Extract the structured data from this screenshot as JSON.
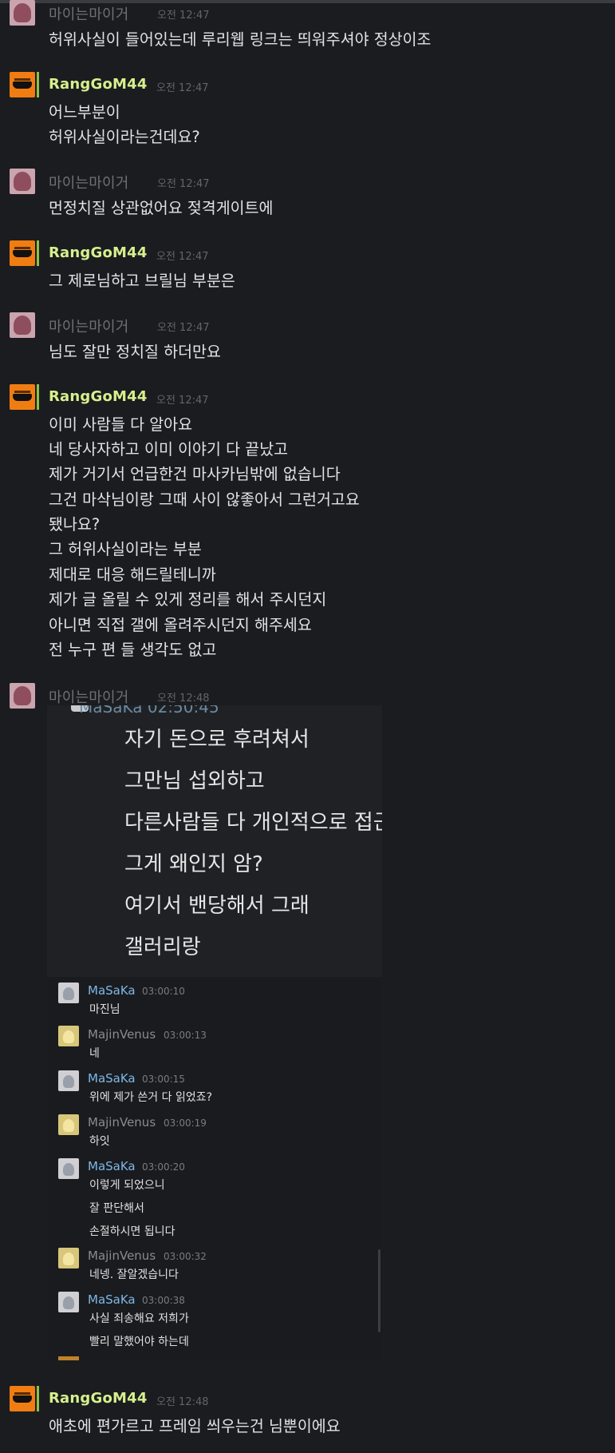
{
  "messages": [
    {
      "author": "마이는마이거",
      "time": "오전 12:47",
      "lines": [
        "허위사실이 들어있는데 루리웹 링크는 띄워주셔야 정상이조"
      ]
    },
    {
      "author": "RangGoM44",
      "time": "오전 12:47",
      "lines": [
        "어느부분이",
        "허위사실이라는건데요?"
      ]
    },
    {
      "author": "마이는마이거",
      "time": "오전 12:47",
      "lines": [
        "먼정치질 상관없어요 젖격게이트에"
      ]
    },
    {
      "author": "RangGoM44",
      "time": "오전 12:47",
      "lines": [
        "그 제로님하고 브릴님 부분은"
      ]
    },
    {
      "author": "마이는마이거",
      "time": "오전 12:47",
      "lines": [
        "님도 잘만 정치질 하더만요"
      ]
    },
    {
      "author": "RangGoM44",
      "time": "오전 12:47",
      "lines": [
        "이미 사람들 다 알아요",
        "네 당사자하고 이미 이야기 다 끝났고",
        "제가 거기서 언급한건 마사카님밖에 없습니다",
        "그건 마삭님이랑 그때 사이 않좋아서 그런거고요",
        "됐나요?",
        "그 허위사실이라는 부분",
        "제대로 대응 해드릴테니까",
        "제가 글 올릴 수 있게 정리를 해서 주시던지",
        "아니면 직접 갤에 올려주시던지 해주세요",
        "전 누구 편 들 생각도 없고"
      ]
    },
    {
      "author": "마이는마이거",
      "time": "오전 12:48",
      "lines": []
    },
    {
      "author": "RangGoM44",
      "time": "오전 12:48",
      "lines": [
        "애초에 편가르고 프레임 씌우는건 님뿐이에요"
      ]
    }
  ],
  "embed": {
    "cut_header": "MaSaKa  02:50:45",
    "big_lines": [
      "자기 돈으로 후려쳐서",
      "그만님 섭외하고",
      "다른사람들 다 개인적으로 접근해서 긁어모으고",
      "그게 왜인지 암?",
      "여기서 밴당해서 그래",
      "갤러리랑"
    ],
    "chat": [
      {
        "author": "MaSaKa",
        "time": "03:00:10",
        "lines": [
          "마진님"
        ]
      },
      {
        "author": "MajinVenus",
        "time": "03:00:13",
        "lines": [
          "네"
        ]
      },
      {
        "author": "MaSaKa",
        "time": "03:00:15",
        "lines": [
          "위에 제가 쓴거 다 읽었죠?"
        ]
      },
      {
        "author": "MajinVenus",
        "time": "03:00:19",
        "lines": [
          "하잇"
        ]
      },
      {
        "author": "MaSaKa",
        "time": "03:00:20",
        "lines": [
          "이렇게 되었으니",
          "잘 판단해서",
          "손절하시면 됩니다"
        ]
      },
      {
        "author": "MajinVenus",
        "time": "03:00:32",
        "lines": [
          "네넹. 잘알겠습니다"
        ]
      },
      {
        "author": "MaSaKa",
        "time": "03:00:38",
        "lines": [
          "사실 죄송해요 저희가",
          "빨리 말했어야 하는데"
        ]
      }
    ]
  }
}
